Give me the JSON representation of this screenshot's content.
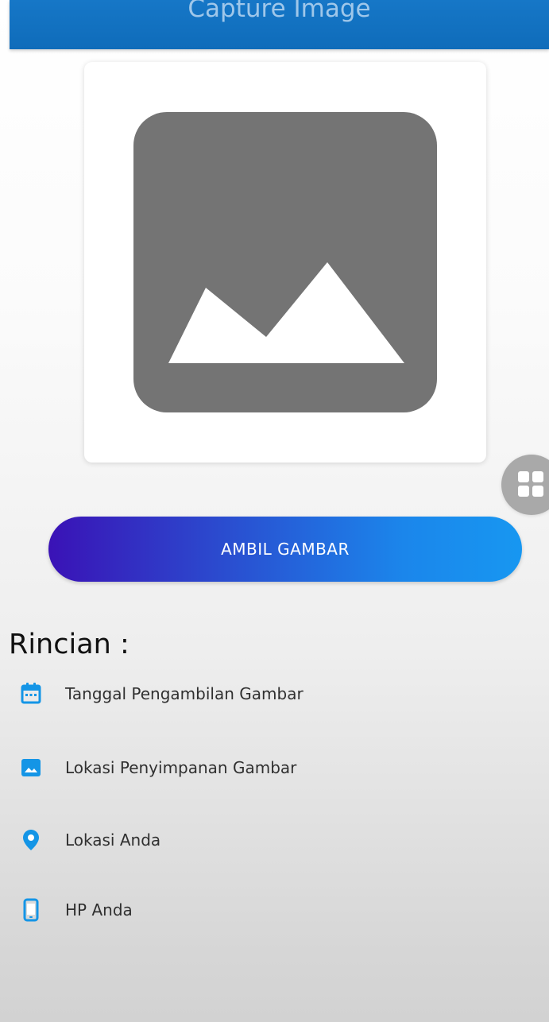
{
  "header": {
    "title": "Capture Image"
  },
  "image_preview": {
    "placeholder_icon": "image-placeholder-icon"
  },
  "floating_button": {
    "icon": "grid-icon"
  },
  "action": {
    "capture_label": "AMBIL GAMBAR"
  },
  "details": {
    "title": "Rincian :",
    "items": [
      {
        "label": "Tanggal Pengambilan Gambar",
        "icon": "calendar-icon"
      },
      {
        "label": "Lokasi Penyimpanan Gambar",
        "icon": "image-icon"
      },
      {
        "label": "Lokasi Anda",
        "icon": "location-pin-icon"
      },
      {
        "label": "HP Anda",
        "icon": "phone-icon"
      }
    ]
  },
  "colors": {
    "header": "#1677c7",
    "button_start": "#3a12b6",
    "button_end": "#1797f1",
    "accent": "#1495e6",
    "placeholder": "#747474"
  }
}
